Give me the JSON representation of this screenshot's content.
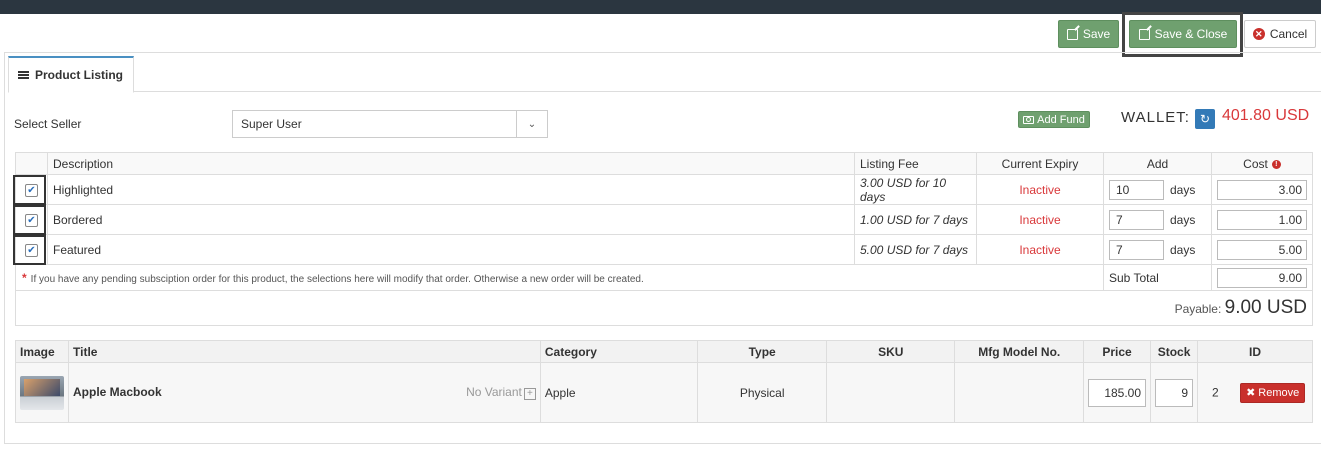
{
  "toolbar": {
    "save_label": "Save",
    "save_close_label": "Save & Close",
    "cancel_label": "Cancel"
  },
  "tab": {
    "label": "Product Listing"
  },
  "seller": {
    "label": "Select Seller",
    "selected": "Super User"
  },
  "wallet": {
    "add_fund_label": "Add Fund",
    "label": "WALLET:",
    "amount": "401.80 USD"
  },
  "fees": {
    "headers": [
      "Description",
      "Listing Fee",
      "Current Expiry",
      "Add",
      "Cost"
    ],
    "rows": [
      {
        "checked": true,
        "description": "Highlighted",
        "listing_fee": "3.00 USD for 10 days",
        "expiry": "Inactive",
        "add": "10",
        "unit": "days",
        "cost": "3.00"
      },
      {
        "checked": true,
        "description": "Bordered",
        "listing_fee": "1.00 USD for 7 days",
        "expiry": "Inactive",
        "add": "7",
        "unit": "days",
        "cost": "1.00"
      },
      {
        "checked": true,
        "description": "Featured",
        "listing_fee": "5.00 USD for 7 days",
        "expiry": "Inactive",
        "add": "7",
        "unit": "days",
        "cost": "5.00"
      }
    ],
    "note_star": "*",
    "note": "If you have any pending subsciption order for this product, the selections here will modify that order. Otherwise a new order will be created.",
    "subtotal_label": "Sub Total",
    "subtotal_value": "9.00",
    "payable_label": "Payable:",
    "payable_amount": "9.00 USD"
  },
  "products": {
    "headers": [
      "Image",
      "Title",
      "Category",
      "Type",
      "SKU",
      "Mfg Model No.",
      "Price",
      "Stock",
      "ID"
    ],
    "rows": [
      {
        "title": "Apple Macbook",
        "variant": "No Variant",
        "category": "Apple",
        "type": "Physical",
        "sku": "",
        "mfg_model": "",
        "price": "185.00",
        "stock": "9",
        "id": "2",
        "remove_label": "Remove"
      }
    ]
  },
  "colors": {
    "accent_green": "#6fa06f",
    "danger_red": "#c9302c",
    "wallet_red": "#d9383a",
    "primary_blue": "#337ab7"
  }
}
